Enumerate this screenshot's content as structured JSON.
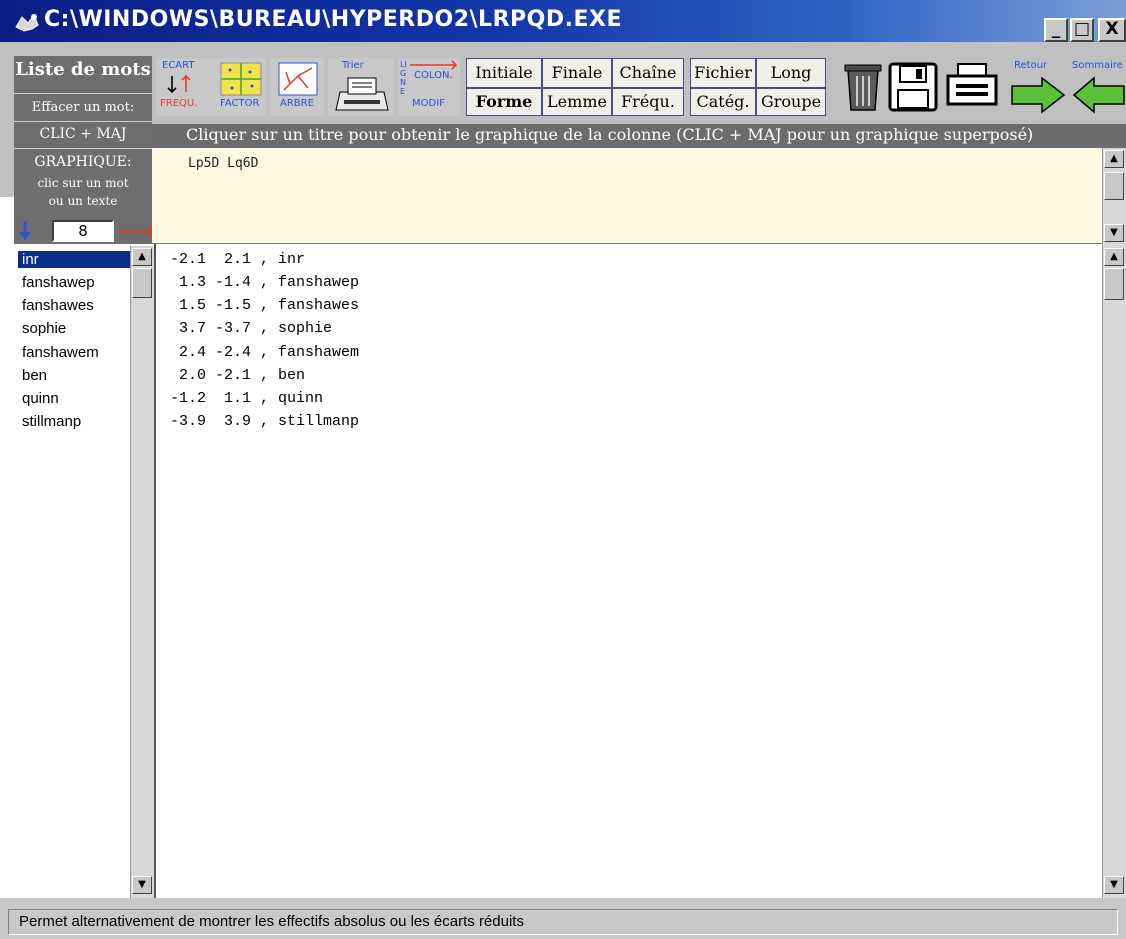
{
  "window": {
    "title": "C:\\WINDOWS\\BUREAU\\HYPERDO2\\LRPQD.EXE",
    "min_label": "_",
    "max_label": "□",
    "close_label": "X"
  },
  "left_panel": {
    "title": "Liste de mots",
    "effacer": "Effacer un mot:",
    "clic_maj": "CLIC + MAJ",
    "graphique": "GRAPHIQUE:",
    "clic_mot": "clic sur un mot",
    "ou_texte": "ou un texte",
    "count": "8"
  },
  "toolbar": {
    "ecart": "ECART",
    "frequ": "FREQU.",
    "factor": "FACTOR",
    "arbre": "ARBRE",
    "trier": "Trier",
    "colon": "COLON.",
    "modif": "MODIF",
    "ligne_letters": "LIGNE",
    "retour": "Retour",
    "sommaire": "Sommaire",
    "grid_row1": [
      "Initiale",
      "Finale",
      "Chaîne",
      "Fichier",
      "Long"
    ],
    "grid_row2": [
      "Forme",
      "Lemme",
      "Fréqu.",
      "Catég.",
      "Groupe"
    ]
  },
  "instruction": "Cliquer sur un titre pour obtenir le graphique de la colonne (CLIC + MAJ pour un graphique superposé)",
  "top_panel_text": "Lp5D  Lq6D",
  "words": [
    "inr",
    "fanshawep",
    "fanshawes",
    "sophie",
    "fanshawem",
    "ben",
    "quinn",
    "stillmanp"
  ],
  "rows": [
    "-2.1  2.1 , inr",
    " 1.3 -1.4 , fanshawep",
    " 1.5 -1.5 , fanshawes",
    " 3.7 -3.7 , sophie",
    " 2.4 -2.4 , fanshawem",
    " 2.0 -2.1 , ben",
    "-1.2  1.1 , quinn",
    "-3.9  3.9 , stillmanp"
  ],
  "status": "Permet alternativement de montrer les effectifs absolus ou les écarts réduits",
  "colors": {
    "titlebar": "#0b1c85",
    "panel_grey": "#6e6e6e",
    "selection": "#0a2e8a",
    "top_panel_bg": "#fdf9e1",
    "arrow_green": "#5bbf3a"
  }
}
